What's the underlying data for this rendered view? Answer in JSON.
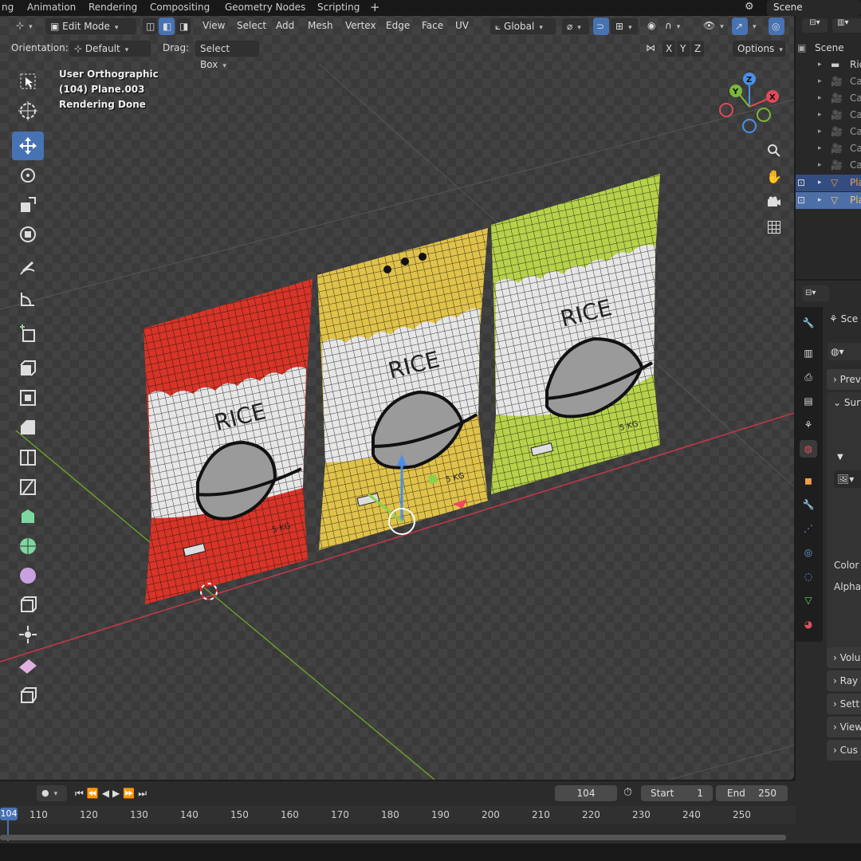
{
  "workspace_tabs": [
    "ng",
    "Animation",
    "Rendering",
    "Compositing",
    "Geometry Nodes",
    "Scripting",
    "+"
  ],
  "scene_name": "Scene",
  "header": {
    "mode": "Edit Mode",
    "menus": [
      "View",
      "Select",
      "Add",
      "Mesh",
      "Vertex",
      "Edge",
      "Face",
      "UV"
    ],
    "transform_orientation": "Global",
    "axis_x": "X",
    "axis_y": "Y",
    "axis_z": "Z"
  },
  "tool_settings": {
    "orientation_label": "Orientation:",
    "orientation_value": "Default",
    "drag_label": "Drag:",
    "drag_value": "Select Box",
    "options": "Options"
  },
  "viewport_info": {
    "view": "User Orthographic",
    "object": "(104) Plane.003",
    "status": "Rendering Done"
  },
  "gizmo": {
    "x": "X",
    "y": "Y",
    "z": "Z"
  },
  "bags": [
    {
      "title": "RICE",
      "weight": "5 KG",
      "color": "#d83428"
    },
    {
      "title": "RICE",
      "weight": "5 KG",
      "color": "#e0c24a"
    },
    {
      "title": "RICE",
      "weight": "5 KG",
      "color": "#b6d24a"
    }
  ],
  "outliner": {
    "header": "Scene",
    "rows": [
      {
        "label": "Ric",
        "type": "collection"
      },
      {
        "label": "Ca",
        "type": "camera"
      },
      {
        "label": "Ca",
        "type": "camera"
      },
      {
        "label": "Ca",
        "type": "camera"
      },
      {
        "label": "Ca",
        "type": "camera"
      },
      {
        "label": "Ca",
        "type": "camera"
      },
      {
        "label": "Ca",
        "type": "camera"
      },
      {
        "label": "Pla",
        "type": "mesh",
        "selected": true
      },
      {
        "label": "Pla",
        "type": "mesh",
        "selected": true
      }
    ]
  },
  "properties": {
    "context": "Sce",
    "panels": [
      "Prev",
      "Surf",
      "Volu",
      "Ray",
      "Sett",
      "View",
      "Cus"
    ],
    "color_label": "Color",
    "alpha_label": "Alpha"
  },
  "timeline": {
    "current_frame": "104",
    "start_label": "Start",
    "start": "1",
    "end_label": "End",
    "end": "250",
    "ticks": [
      "104",
      "110",
      "120",
      "130",
      "140",
      "150",
      "160",
      "170",
      "180",
      "190",
      "200",
      "210",
      "220",
      "230",
      "240",
      "250"
    ]
  },
  "colors": {
    "accent": "#4772b3",
    "viewport_bg": "#3d3d3d",
    "x_axis": "#c8364a",
    "y_axis": "#6a9a2c"
  }
}
